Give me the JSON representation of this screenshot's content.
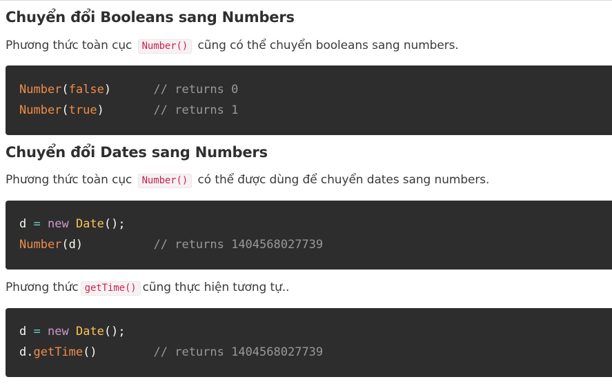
{
  "section_booleans": {
    "heading": "Chuyển đổi Booleans sang Numbers",
    "text_before": "Phương thức toàn cục",
    "inline_code": "Number()",
    "text_after": "cũng có thể chuyển booleans sang numbers.",
    "code": {
      "line1": {
        "fn": "Number",
        "open": "(",
        "arg": "false",
        "close": ")",
        "comment": "// returns 0"
      },
      "line2": {
        "fn": "Number",
        "open": "(",
        "arg": "true",
        "close": ")",
        "comment": "// returns 1"
      }
    }
  },
  "section_dates": {
    "heading": "Chuyển đổi Dates sang Numbers",
    "text_before": "Phương thức toàn cục",
    "inline_code": "Number()",
    "text_after": "có thể được dùng để chuyển dates sang numbers.",
    "code": {
      "line1": {
        "var": "d",
        "eq": "=",
        "new": "new",
        "cls": "Date",
        "tail": "();"
      },
      "line2": {
        "fn": "Number",
        "rest": "(d)",
        "comment": "// returns 1404568027739"
      }
    }
  },
  "section_gettime": {
    "text_before": "Phương thức",
    "inline_code": "getTime()",
    "text_after": "cũng thực hiện tương tự..",
    "code": {
      "line1": {
        "var": "d",
        "eq": "=",
        "new": "new",
        "cls": "Date",
        "tail": "();"
      },
      "line2": {
        "obj": "d.",
        "fn": "getTime",
        "rest": "()",
        "comment": "// returns 1404568027739"
      }
    }
  },
  "colors": {
    "code_background": "#2d2d2d",
    "function": "#f08d49",
    "keyword_new": "#cc99cd",
    "class_name": "#f8c555",
    "comment": "#999999",
    "inline_code": "#c7254e"
  }
}
